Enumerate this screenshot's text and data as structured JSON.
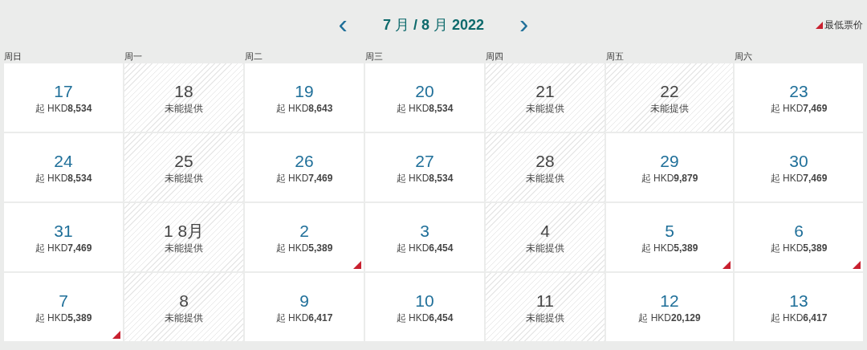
{
  "header": {
    "prev": "‹",
    "title": "**7** 月 **/ 8** 月 **2022**",
    "next": "›",
    "legend": "最低票价"
  },
  "weekdays": [
    "周日",
    "周一",
    "周二",
    "周三",
    "周四",
    "周五",
    "周六"
  ],
  "weeks": [
    [
      {
        "day": "17",
        "available": true,
        "price": "起 HKD**8,534**",
        "lowest": false
      },
      {
        "day": "18",
        "available": false,
        "price": "未能提供",
        "lowest": false
      },
      {
        "day": "19",
        "available": true,
        "price": "起 HKD**8,643**",
        "lowest": false
      },
      {
        "day": "20",
        "available": true,
        "price": "起 HKD**8,534**",
        "lowest": false
      },
      {
        "day": "21",
        "available": false,
        "price": "未能提供",
        "lowest": false
      },
      {
        "day": "22",
        "available": false,
        "price": "未能提供",
        "lowest": false
      },
      {
        "day": "23",
        "available": true,
        "price": "起 HKD**7,469**",
        "lowest": false
      }
    ],
    [
      {
        "day": "24",
        "available": true,
        "price": "起 HKD**8,534**",
        "lowest": false
      },
      {
        "day": "25",
        "available": false,
        "price": "未能提供",
        "lowest": false
      },
      {
        "day": "26",
        "available": true,
        "price": "起 HKD**7,469**",
        "lowest": false
      },
      {
        "day": "27",
        "available": true,
        "price": "起 HKD**8,534**",
        "lowest": false
      },
      {
        "day": "28",
        "available": false,
        "price": "未能提供",
        "lowest": false
      },
      {
        "day": "29",
        "available": true,
        "price": "起 HKD**9,879**",
        "lowest": false
      },
      {
        "day": "30",
        "available": true,
        "price": "起 HKD**7,469**",
        "lowest": false
      }
    ],
    [
      {
        "day": "31",
        "available": true,
        "price": "起 HKD**7,469**",
        "lowest": false
      },
      {
        "day": "1 8月",
        "available": false,
        "price": "未能提供",
        "lowest": false
      },
      {
        "day": "2",
        "available": true,
        "price": "起 HKD**5,389**",
        "lowest": true
      },
      {
        "day": "3",
        "available": true,
        "price": "起 HKD**6,454**",
        "lowest": false
      },
      {
        "day": "4",
        "available": false,
        "price": "未能提供",
        "lowest": false
      },
      {
        "day": "5",
        "available": true,
        "price": "起 HKD**5,389**",
        "lowest": true
      },
      {
        "day": "6",
        "available": true,
        "price": "起 HKD**5,389**",
        "lowest": true
      }
    ],
    [
      {
        "day": "7",
        "available": true,
        "price": "起 HKD**5,389**",
        "lowest": true
      },
      {
        "day": "8",
        "available": false,
        "price": "未能提供",
        "lowest": false
      },
      {
        "day": "9",
        "available": true,
        "price": "起 HKD**6,417**",
        "lowest": false
      },
      {
        "day": "10",
        "available": true,
        "price": "起 HKD**6,454**",
        "lowest": false
      },
      {
        "day": "11",
        "available": false,
        "price": "未能提供",
        "lowest": false
      },
      {
        "day": "12",
        "available": true,
        "price": "起 HKD**20,129**",
        "lowest": false
      },
      {
        "day": "13",
        "available": true,
        "price": "起 HKD**6,417**",
        "lowest": false
      }
    ]
  ]
}
